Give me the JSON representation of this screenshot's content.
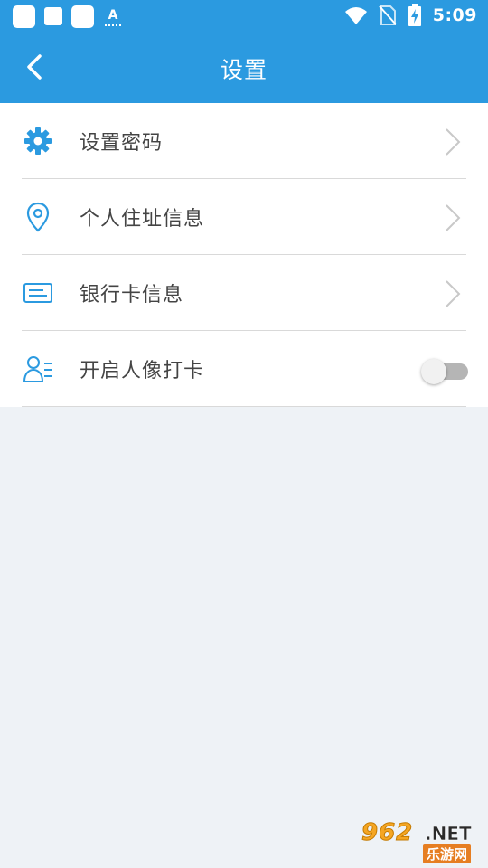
{
  "status_bar": {
    "time": "5:09",
    "left_icons": [
      "app-square-icon",
      "app-square-icon",
      "app-square-icon",
      "accessibility-a-icon"
    ],
    "a_glyph": "A",
    "right_icons": [
      "wifi-icon",
      "no-sim-icon",
      "battery-charging-icon"
    ]
  },
  "header": {
    "title": "设置",
    "back_icon": "chevron-left-icon"
  },
  "settings": {
    "items": [
      {
        "label": "设置密码",
        "icon": "gear-icon",
        "control": "chevron"
      },
      {
        "label": "个人住址信息",
        "icon": "location-pin-icon",
        "control": "chevron"
      },
      {
        "label": "银行卡信息",
        "icon": "bank-card-icon",
        "control": "chevron"
      },
      {
        "label": "开启人像打卡",
        "icon": "face-checkin-icon",
        "control": "toggle",
        "toggle_on": false
      }
    ]
  },
  "watermark": {
    "top": "962",
    "net": ".NET",
    "bottom": "乐游网"
  },
  "colors": {
    "primary": "#2b9ae0",
    "background": "#eef2f6",
    "list_background": "#ffffff",
    "label_text": "#444444",
    "divider": "#d9d9d9",
    "chevron": "#c8c8c8",
    "toggle_track": "#b5b5b5"
  }
}
